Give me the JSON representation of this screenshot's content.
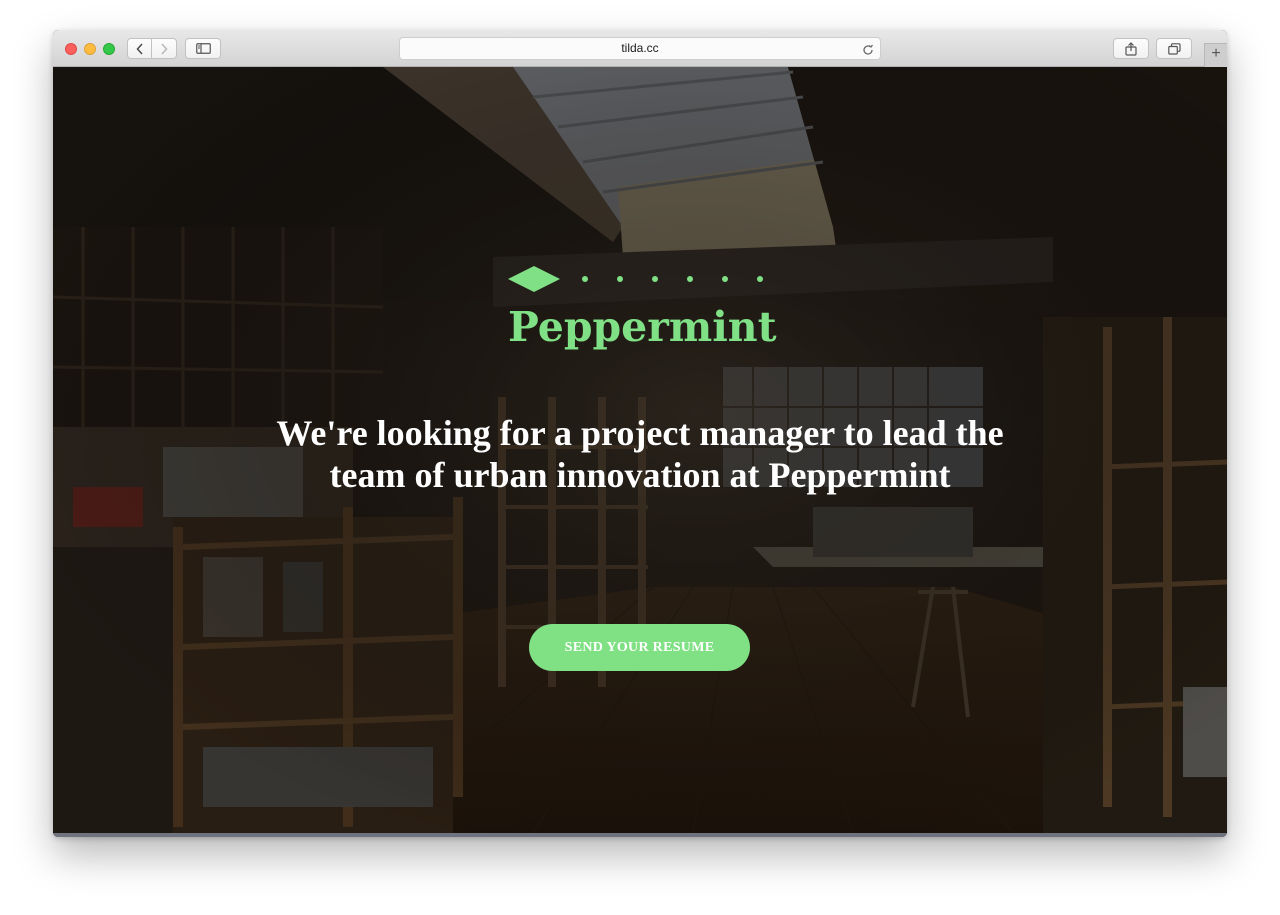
{
  "browser": {
    "url": "tilda.cc",
    "back_icon": "chevron-left-icon",
    "forward_icon": "chevron-right-icon",
    "sidebar_icon": "sidebar-icon",
    "share_icon": "share-icon",
    "tabs_icon": "tabs-overview-icon",
    "reload_icon": "reload-icon",
    "new_tab_icon": "plus-icon"
  },
  "hero": {
    "brand": "Peppermint",
    "headline": "We're looking for a project manager to lead the team of urban innovation at Peppermint",
    "cta_label": "SEND YOUR RESUME",
    "accent_color": "#7fe085",
    "logo_icon": "diamond-dots-logo-icon"
  }
}
